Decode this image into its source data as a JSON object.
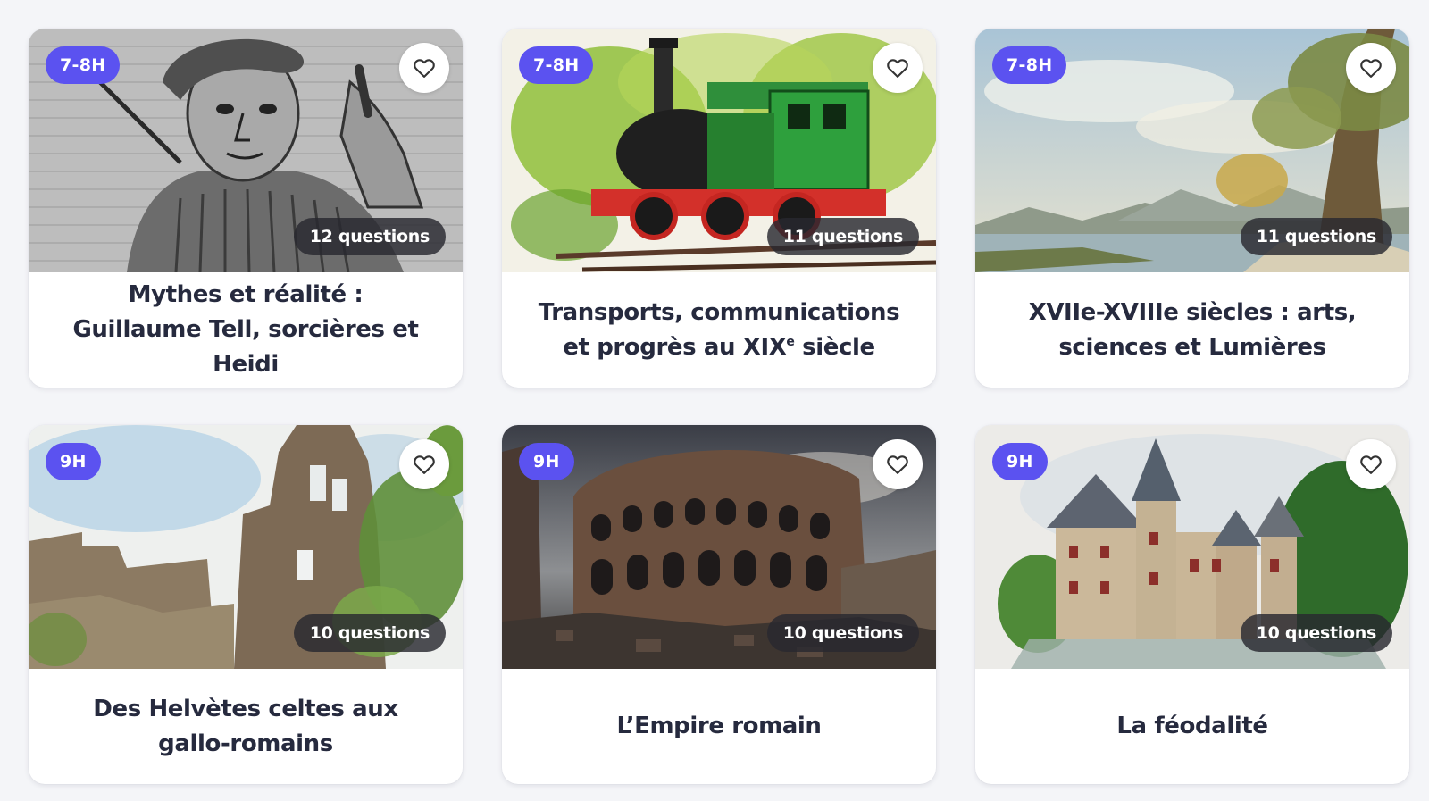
{
  "courses": [
    {
      "level": "7-8H",
      "questions": "12 questions",
      "title": "Mythes et réalité : Guillaume Tell, sorcières et Heidi",
      "image": "engraving-portrait-man-with-arrow"
    },
    {
      "level": "7-8H",
      "questions": "11 questions",
      "title_main": "Transports, communications et progrès au XIX",
      "title_sup": "e",
      "title_end": " siècle",
      "image": "watercolor-steam-locomotive"
    },
    {
      "level": "7-8H",
      "questions": "11 questions",
      "title": "XVIIe-XVIIIe siècles : arts, sciences et Lumières",
      "image": "landscape-painting-lake-tree"
    },
    {
      "level": "9H",
      "questions": "10 questions",
      "title": "Des Helvètes celtes aux gallo-romains",
      "image": "watercolor-castle-ruins"
    },
    {
      "level": "9H",
      "questions": "10 questions",
      "title": "L’Empire romain",
      "image": "colosseum-ruins"
    },
    {
      "level": "9H",
      "questions": "10 questions",
      "title": "La féodalité",
      "image": "watercolor-medieval-castle"
    }
  ],
  "icons": {
    "favorite": "heart-outline-icon"
  },
  "colors": {
    "level_badge": "#5b52f0",
    "count_badge": "#2e2e36",
    "title_text": "#262a3e",
    "card_bg": "#ffffff",
    "page_bg": "#f4f5f8"
  }
}
